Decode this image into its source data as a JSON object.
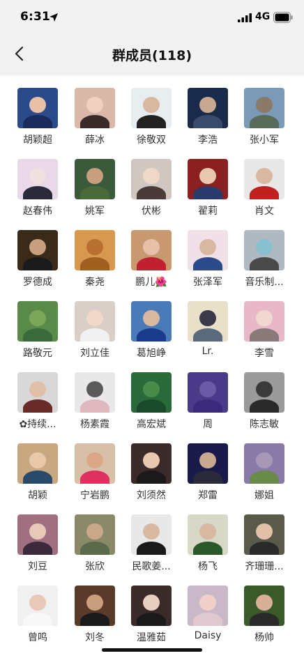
{
  "status_bar": {
    "time": "6:31",
    "network": "4G"
  },
  "nav": {
    "title": "群成员(118)"
  },
  "icons": {
    "back": "chevron-left-icon",
    "location": "location-arrow-icon",
    "signal": "cellular-signal-icon",
    "battery": "battery-icon"
  },
  "members": [
    {
      "name": "胡颖超",
      "bg": "#2a4a8a",
      "head": "#e8c0a8",
      "body": "#1a2a5a"
    },
    {
      "name": "薛冰",
      "bg": "#d9b8a8",
      "head": "#f0d0c0",
      "body": "#3a2a2a"
    },
    {
      "name": "徐敬双",
      "bg": "#e8eef0",
      "head": "#d8b8a0",
      "body": "#222222"
    },
    {
      "name": "李浩",
      "bg": "#1a2a4a",
      "head": "#c8a890",
      "body": "#3a4a6a"
    },
    {
      "name": "张小军",
      "bg": "#7a9ab8",
      "head": "#8a7a6a",
      "body": "#5a6a5a"
    },
    {
      "name": "赵春伟",
      "bg": "#e8d8e8",
      "head": "#f0e0e0",
      "body": "#2a2a3a"
    },
    {
      "name": "姚军",
      "bg": "#3a5a3a",
      "head": "#c8a080",
      "body": "#4a6a3a"
    },
    {
      "name": "伏彬",
      "bg": "#d0c8c0",
      "head": "#f0d8c8",
      "body": "#4a3a3a"
    },
    {
      "name": "翟莉",
      "bg": "#8a2020",
      "head": "#e8c8b0",
      "body": "#2a3a6a"
    },
    {
      "name": "肖文",
      "bg": "#e8e8e8",
      "head": "#d8b8a0",
      "body": "#c02020"
    },
    {
      "name": "罗德成",
      "bg": "#3a2a1a",
      "head": "#c8a080",
      "body": "#1a1a1a"
    },
    {
      "name": "秦尧",
      "bg": "#d89850",
      "head": "#b87030",
      "body": "#a06020"
    },
    {
      "name": "鹏儿🌺",
      "bg": "#c89870",
      "head": "#e8c0a8",
      "body": "#c02030"
    },
    {
      "name": "张泽军",
      "bg": "#f0e0e8",
      "head": "#d8b8a0",
      "body": "#2a4a8a"
    },
    {
      "name": "音乐制...",
      "bg": "#b0b8c0",
      "head": "#88c0d0",
      "body": "#4a4a4a"
    },
    {
      "name": "路敬元",
      "bg": "#5a8a4a",
      "head": "#7aa858",
      "body": "#3a6a3a"
    },
    {
      "name": "刘立佳",
      "bg": "#d8d0c8",
      "head": "#f0d8c8",
      "body": "#f0f0f0"
    },
    {
      "name": "葛旭峥",
      "bg": "#4a7ab8",
      "head": "#d8b8a0",
      "body": "#1a3a8a"
    },
    {
      "name": "Lr.",
      "bg": "#e8e0c8",
      "head": "#3a3a4a",
      "body": "#5a6a7a"
    },
    {
      "name": "李雪",
      "bg": "#e8b8c8",
      "head": "#f0d8d0",
      "body": "#8a7a7a"
    },
    {
      "name": "✿持续...",
      "bg": "#d8d8d8",
      "head": "#e0c0a8",
      "body": "#6a2a2a"
    },
    {
      "name": "杨素霞",
      "bg": "#e8e8e8",
      "head": "#5a5a5a",
      "body": "#e0b8c0"
    },
    {
      "name": "高宏斌",
      "bg": "#2a6a3a",
      "head": "#4a8a4a",
      "body": "#1a4a2a"
    },
    {
      "name": "周",
      "bg": "#4a3a8a",
      "head": "#6a5aa8",
      "body": "#3a2a7a"
    },
    {
      "name": "陈志敏",
      "bg": "#9a9a9a",
      "head": "#3a3a3a",
      "body": "#2a2a2a"
    },
    {
      "name": "胡颖",
      "bg": "#c8a880",
      "head": "#e8c8a8",
      "body": "#2a4a6a"
    },
    {
      "name": "宁岩鹏",
      "bg": "#d8c0a8",
      "head": "#d8a888",
      "body": "#e03060"
    },
    {
      "name": "刘须然",
      "bg": "#3a2a2a",
      "head": "#e8c8b0",
      "body": "#1a1a1a"
    },
    {
      "name": "郑雷",
      "bg": "#1a1a4a",
      "head": "#c8a890",
      "body": "#2a2a3a"
    },
    {
      "name": "娜姐",
      "bg": "#8a7aa8",
      "head": "#a898b8",
      "body": "#6a8a4a"
    },
    {
      "name": "刘豆",
      "bg": "#a07080",
      "head": "#e8c8b8",
      "body": "#3a2a3a"
    },
    {
      "name": "张欣",
      "bg": "#8a8a6a",
      "head": "#c8a888",
      "body": "#5a6a4a"
    },
    {
      "name": "民歌姜...",
      "bg": "#e8e8e8",
      "head": "#d8b8a0",
      "body": "#1a1a1a"
    },
    {
      "name": "杨飞",
      "bg": "#d8d8c8",
      "head": "#d8b8a0",
      "body": "#2a5a2a"
    },
    {
      "name": "齐珊珊...",
      "bg": "#5a5a4a",
      "head": "#e0c0a8",
      "body": "#2a2a2a"
    },
    {
      "name": "曾鸣",
      "bg": "#f0f0f0",
      "head": "#e8c8b8",
      "body": "#f8f8f8"
    },
    {
      "name": "刘冬",
      "bg": "#5a3a2a",
      "head": "#c8a080",
      "body": "#1a1a1a"
    },
    {
      "name": "温雅茹",
      "bg": "#3a2a2a",
      "head": "#e8d0c0",
      "body": "#1a1a1a"
    },
    {
      "name": "Daisy",
      "bg": "#c8b8c8",
      "head": "#f0d0c8",
      "body": "#e0c8d0"
    },
    {
      "name": "杨帅",
      "bg": "#3a5a2a",
      "head": "#d8b098",
      "body": "#2a2a2a"
    }
  ]
}
